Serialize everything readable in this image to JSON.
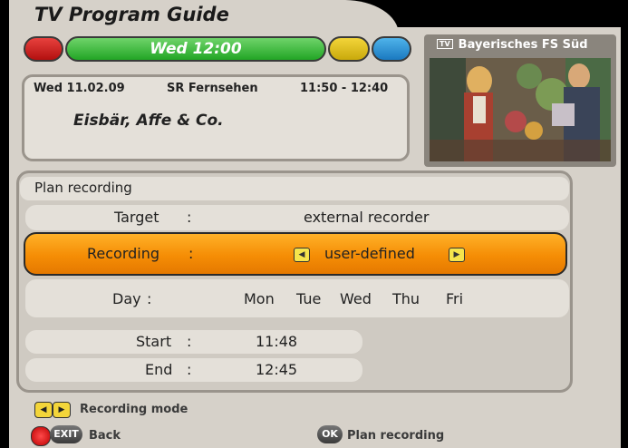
{
  "header": {
    "title": "TV Program Guide"
  },
  "color_bar": {
    "current": "Wed 12:00"
  },
  "program": {
    "date": "Wed  11.02.09",
    "channel": "SR Fernsehen",
    "time": "11:50 - 12:40",
    "title": "Eisbär, Affe & Co."
  },
  "preview": {
    "channel": "Bayerisches FS Süd",
    "tv_icon": "TV"
  },
  "panel": {
    "title": "Plan recording",
    "target_label": "Target",
    "target_value": "external recorder",
    "recording_label": "Recording",
    "recording_value": "user-defined",
    "day_label": "Day",
    "days": [
      "Mon",
      "Tue",
      "Wed",
      "Thu",
      "Fri"
    ],
    "start_label": "Start",
    "start_value": "11:48",
    "end_label": "End",
    "end_value": "12:45",
    "sep": ":"
  },
  "footer": {
    "mode_label": "Recording mode",
    "exit_key": "EXIT",
    "back_label": "Back",
    "ok_key": "OK",
    "plan_label": "Plan recording"
  },
  "icons": [
    "left-arrow-icon",
    "right-arrow-icon",
    "tv-icon",
    "red-button-icon"
  ],
  "colors": {
    "highlight": "#f58d05",
    "green": "#22a525",
    "red": "#d12a28",
    "yellow": "#e8c521",
    "blue": "#2a8fd6"
  }
}
